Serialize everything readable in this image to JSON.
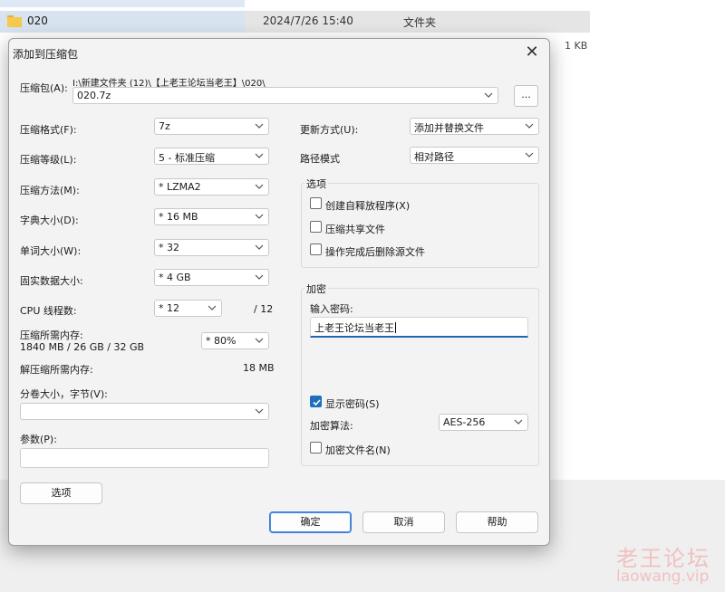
{
  "explorer": {
    "row": {
      "name": "020",
      "date": "2024/7/26 15:40",
      "type": "文件夹"
    },
    "other_size": "1 KB"
  },
  "dialog": {
    "title": "添加到压缩包",
    "archive_label": "压缩包(A):",
    "archive_path": "I:\\新建文件夹 (12)\\【上老王论坛当老王】\\020\\",
    "archive_name": "020.7z",
    "browse_label": "...",
    "left": {
      "format": {
        "label": "压缩格式(F):",
        "value": "7z"
      },
      "level": {
        "label": "压缩等级(L):",
        "value": "5 - 标准压缩"
      },
      "method": {
        "label": "压缩方法(M):",
        "value": "* LZMA2"
      },
      "dict": {
        "label": "字典大小(D):",
        "value": "* 16 MB"
      },
      "word": {
        "label": "单词大小(W):",
        "value": "* 32"
      },
      "solid": {
        "label": "固实数据大小:",
        "value": "* 4 GB"
      },
      "threads": {
        "label": "CPU 线程数:",
        "value": "* 12",
        "max": "/ 12"
      },
      "memory": {
        "label": "压缩所需内存:",
        "detail": "1840 MB / 26 GB / 32 GB",
        "value": "* 80%"
      },
      "decompress": {
        "label": "解压缩所需内存:",
        "value": "18 MB"
      },
      "volume": {
        "label": "分卷大小，字节(V):",
        "value": ""
      },
      "params": {
        "label": "参数(P):",
        "value": ""
      },
      "options_button": "选项"
    },
    "right": {
      "update": {
        "label": "更新方式(U):",
        "value": "添加并替换文件"
      },
      "path_mode": {
        "label": "路径模式",
        "value": "相对路径"
      },
      "options_group": {
        "title": "选项",
        "items": [
          {
            "label": "创建自释放程序(X)",
            "checked": false
          },
          {
            "label": "压缩共享文件",
            "checked": false
          },
          {
            "label": "操作完成后删除源文件",
            "checked": false
          }
        ]
      },
      "encryption": {
        "title": "加密",
        "password_label": "输入密码:",
        "password_value": "上老王论坛当老王",
        "show_password": {
          "label": "显示密码(S)",
          "checked": true
        },
        "method_label": "加密算法:",
        "method_value": "AES-256",
        "encrypt_names": {
          "label": "加密文件名(N)",
          "checked": false
        }
      }
    },
    "buttons": {
      "ok": "确定",
      "cancel": "取消",
      "help": "帮助"
    }
  },
  "watermark": {
    "cn": "老王论坛",
    "en": "laowang.vip"
  },
  "colors": {
    "accent": "#1f6fbe",
    "watermark": "#f2c0c0",
    "folder": "#f6c84b"
  }
}
